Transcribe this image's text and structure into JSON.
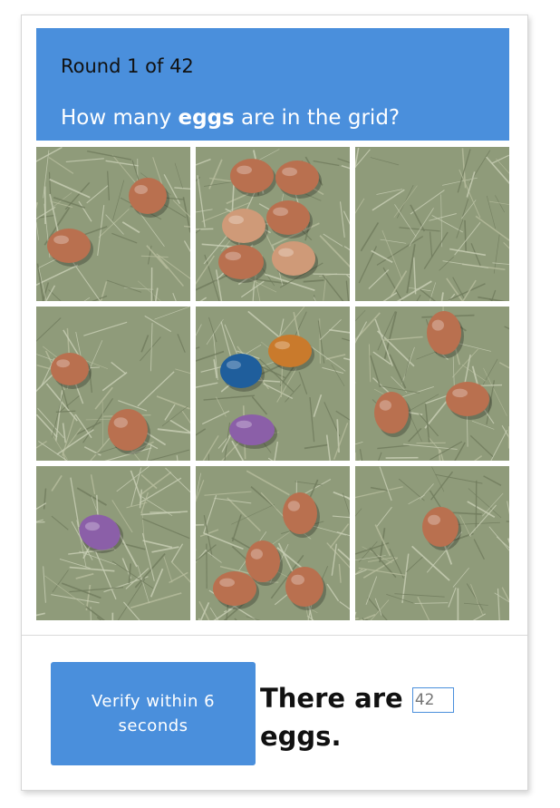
{
  "header": {
    "round_text": "Round 1 of 42",
    "question_prefix": "How many ",
    "question_bold": "eggs",
    "question_suffix": " are in the grid?"
  },
  "grid": {
    "tiles": [
      {
        "egg_count": 2,
        "egg_colors": [
          "brown",
          "brown"
        ]
      },
      {
        "egg_count": 6,
        "egg_colors": [
          "brown",
          "brown",
          "brown",
          "tan",
          "brown",
          "tan"
        ]
      },
      {
        "egg_count": 0,
        "egg_colors": []
      },
      {
        "egg_count": 2,
        "egg_colors": [
          "brown",
          "brown"
        ]
      },
      {
        "egg_count": 3,
        "egg_colors": [
          "blue",
          "orange",
          "purple"
        ]
      },
      {
        "egg_count": 3,
        "egg_colors": [
          "brown",
          "brown",
          "brown"
        ]
      },
      {
        "egg_count": 1,
        "egg_colors": [
          "purple"
        ]
      },
      {
        "egg_count": 4,
        "egg_colors": [
          "brown",
          "brown",
          "brown",
          "brown"
        ]
      },
      {
        "egg_count": 1,
        "egg_colors": [
          "brown"
        ]
      }
    ]
  },
  "footer": {
    "verify_label": "Verify within 6 seconds",
    "answer_prefix": "There are",
    "answer_placeholder": "42",
    "answer_suffix": "eggs."
  },
  "colors": {
    "accent": "#4a8fdc",
    "egg_brown": "#b9704f",
    "egg_tan": "#cf9a78",
    "egg_blue": "#1f5e9c",
    "egg_orange": "#c97a2c",
    "egg_purple": "#8b5fa8",
    "hay": "#8f9b7a"
  }
}
